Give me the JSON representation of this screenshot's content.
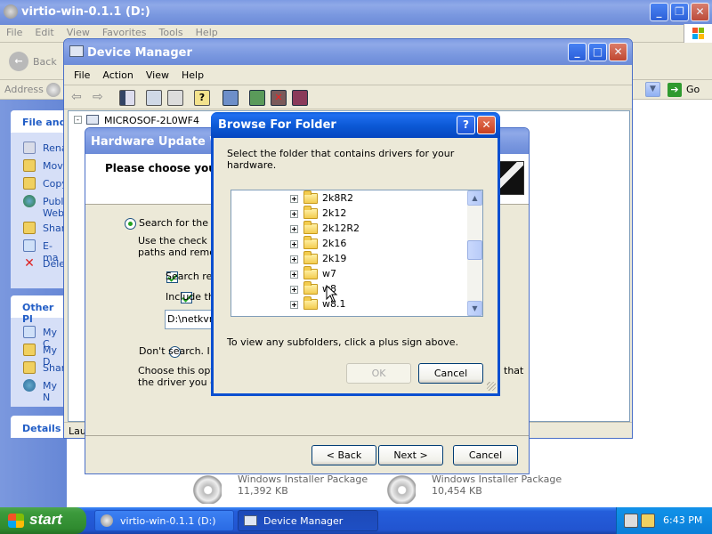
{
  "explorer": {
    "title": "virtio-win-0.1.1 (D:)",
    "menu": [
      "File",
      "Edit",
      "View",
      "Favorites",
      "Tools",
      "Help"
    ],
    "back_label": "Back",
    "address_label": "Address",
    "go_label": "Go",
    "panel_file": "File and",
    "file_tasks": [
      "Rena",
      "Move",
      "Copy",
      "Publi",
      "Web",
      "Shar",
      "E-ma",
      "Delet"
    ],
    "panel_other": "Other Pl",
    "other_places": [
      "My C",
      "My D",
      "Shar",
      "My N"
    ],
    "panel_details": "Details",
    "files": [
      {
        "name": "Windows Installer Package",
        "size": "11,392 KB"
      },
      {
        "name": "Windows Installer Package",
        "size": "10,454 KB"
      }
    ]
  },
  "device_manager": {
    "title": "Device Manager",
    "menu": [
      "File",
      "Action",
      "View",
      "Help"
    ],
    "tree_root": "MICROSOF-2L0WF4",
    "status_partial": "Lau"
  },
  "wizard": {
    "title": "Hardware Update Wiz",
    "header": "Please choose your s",
    "radio_search": "Search for the be",
    "search_desc1": "Use the check bo",
    "search_desc2": "paths and remova",
    "check_removable": "Search rem",
    "check_include": "Include this",
    "path_value": "D:\\netkvm",
    "radio_dont": "Don't search. I wi",
    "dont_desc1": "Choose this optio",
    "dont_desc2": "the driver you cho",
    "dont_desc_right": "that",
    "back_btn": "< Back",
    "next_btn": "Next >",
    "cancel_btn": "Cancel"
  },
  "browse": {
    "title": "Browse For Folder",
    "instruction": "Select the folder that contains drivers for your hardware.",
    "folders": [
      "2k8R2",
      "2k12",
      "2k12R2",
      "2k16",
      "2k19",
      "w7",
      "w8",
      "w8.1"
    ],
    "hint": "To view any subfolders, click a plus sign above.",
    "ok_label": "OK",
    "cancel_label": "Cancel",
    "help_glyph": "?",
    "close_glyph": "✕"
  },
  "taskbar": {
    "start_label": "start",
    "tasks": [
      "virtio-win-0.1.1 (D:)",
      "Device Manager"
    ],
    "clock": "6:43 PM"
  },
  "icons": {
    "explorer": "folder-disc-icon",
    "device_manager": "computer-icon",
    "colors": {
      "xp_blue": "#0a5bd8",
      "taskbar": "#245edb",
      "start_green": "#3c9a3c",
      "tray": "#0f8fe6"
    }
  }
}
